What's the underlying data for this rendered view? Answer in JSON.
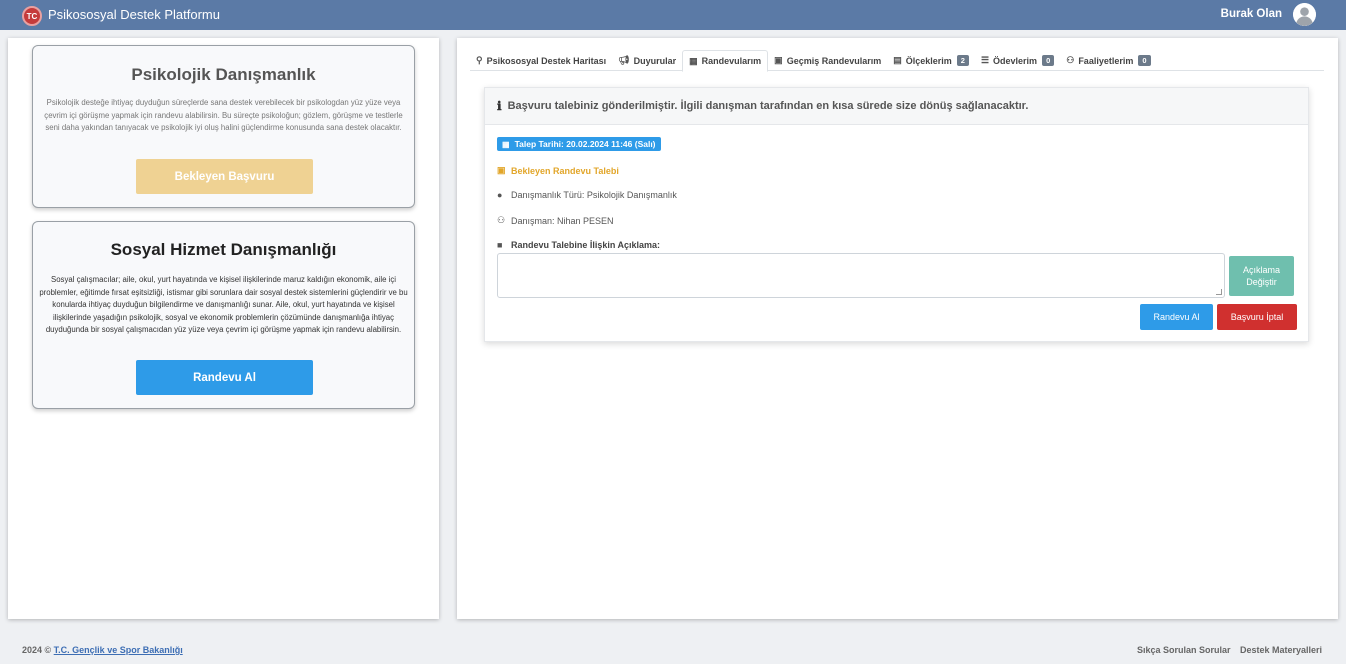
{
  "header": {
    "app_title": "Psikososyal Destek Platformu",
    "user_name": "Burak Olan"
  },
  "left": {
    "card1": {
      "title": "Psikolojik Danışmanlık",
      "text": "Psikolojik desteğe ihtiyaç duyduğun süreçlerde sana destek verebilecek bir psikologdan yüz yüze veya çevrim içi görüşme yapmak için randevu alabilirsin. Bu süreçte psikoloğun; gözlem, görüşme ve testlerle seni daha yakından tanıyacak ve psikolojik iyi oluş halini güçlendirme konusunda sana destek olacaktır.",
      "button": "Bekleyen Başvuru"
    },
    "card2": {
      "title": "Sosyal Hizmet Danışmanlığı",
      "text": "Sosyal çalışmacılar; aile, okul, yurt hayatında ve kişisel ilişkilerinde maruz kaldığın ekonomik, aile içi problemler, eğitimde fırsat eşitsizliği, istismar gibi sorunlara dair sosyal destek sistemlerini güçlendirir ve bu konularda ihtiyaç duyduğun bilgilendirme ve danışmanlığı sunar. Aile, okul, yurt hayatında ve kişisel ilişkilerinde yaşadığın psikolojik, sosyal ve ekonomik problemlerin çözümünde danışmanlığa ihtiyaç duyduğunda bir sosyal çalışmacıdan yüz yüze veya çevrim içi görüşme yapmak için randevu alabilirsin.",
      "button": "Randevu Al"
    }
  },
  "tabs": [
    {
      "label": "Psikososyal Destek Haritası",
      "icon": "map-pin-icon"
    },
    {
      "label": "Duyurular",
      "icon": "megaphone-icon"
    },
    {
      "label": "Randevularım",
      "icon": "calendar-icon",
      "active": true
    },
    {
      "label": "Geçmiş Randevularım",
      "icon": "calendar-check-icon"
    },
    {
      "label": "Ölçeklerim",
      "icon": "clipboard-icon",
      "badge": "2"
    },
    {
      "label": "Ödevlerim",
      "icon": "list-icon",
      "badge": "0"
    },
    {
      "label": "Faaliyetlerim",
      "icon": "users-icon",
      "badge": "0"
    }
  ],
  "appointment": {
    "info_message": "Başvuru talebiniz gönderilmiştir. İlgili danışman tarafından en kısa sürede size dönüş sağlanacaktır.",
    "request_date": "Talep Tarihi: 20.02.2024 11:46 (Salı)",
    "status": "Bekleyen Randevu Talebi",
    "consult_type": "Danışmanlık Türü: Psikolojik Danışmanlık",
    "counselor": "Danışman: Nihan PESEN",
    "desc_label": "Randevu Talebine İlişkin Açıklama:",
    "desc_value": "",
    "edit_button": "Açıklama Değiştir",
    "appt_button": "Randevu Al",
    "cancel_button": "Başvuru İptal"
  },
  "footer": {
    "year": "2024 ©",
    "ministry": "T.C. Gençlik ve Spor Bakanlığı",
    "faq": "Sıkça Sorulan Sorular",
    "materials": "Destek Materyalleri"
  },
  "colors": {
    "topbar": "#5b7aa6",
    "primary": "#2e9be8",
    "warning": "#efd293",
    "danger": "#d0302f",
    "teal": "#6fbfae"
  }
}
